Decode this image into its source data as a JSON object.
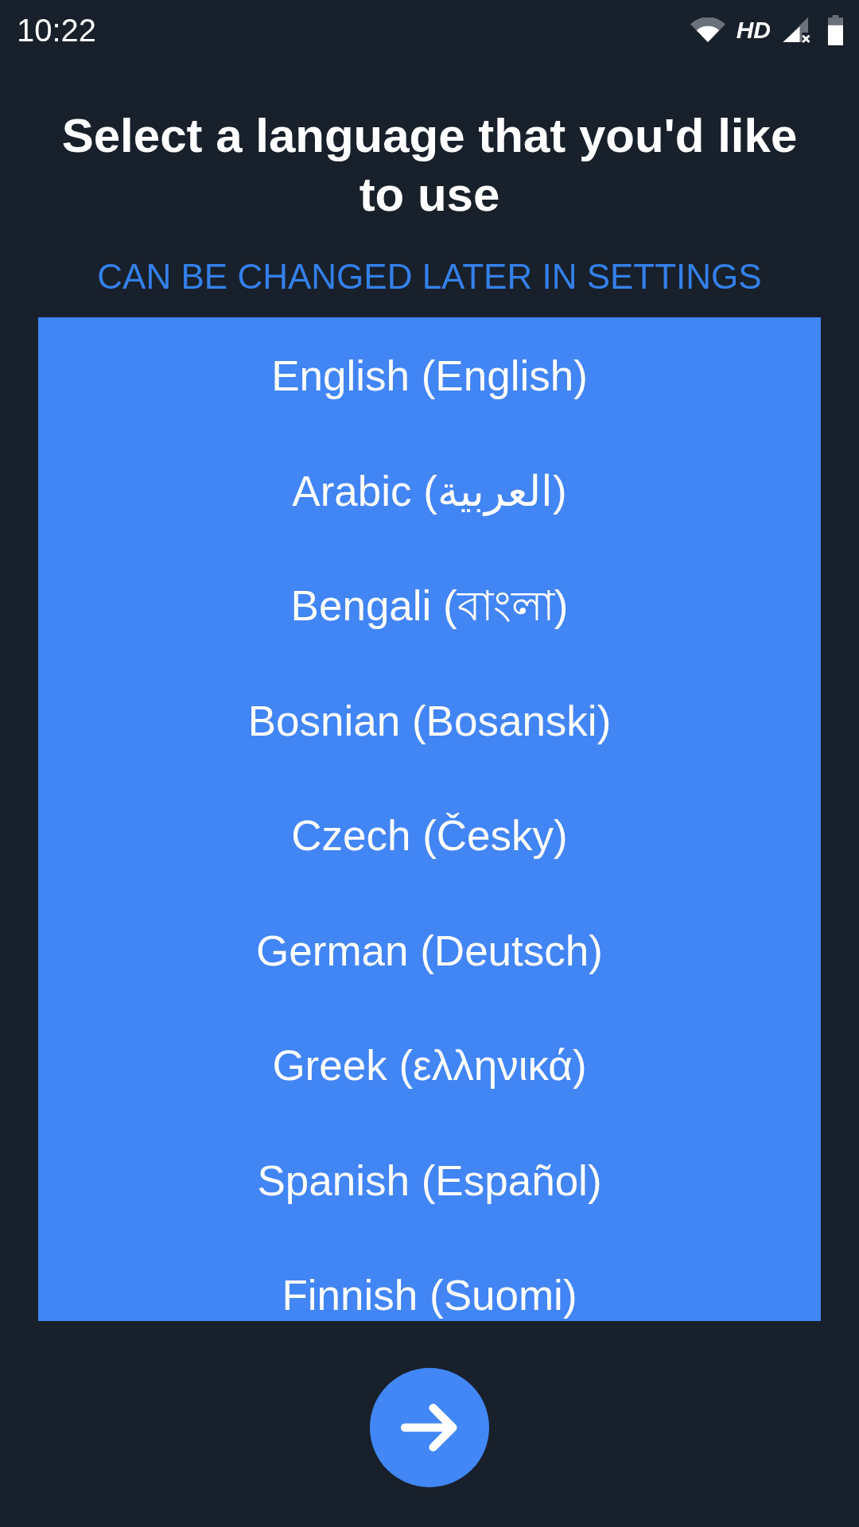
{
  "status_bar": {
    "time": "10:22",
    "network_type": "HD"
  },
  "title": "Select a language that you'd like to use",
  "subtitle": "CAN BE CHANGED LATER IN SETTINGS",
  "languages": [
    {
      "label": "English (English)"
    },
    {
      "label": "Arabic (العربية)"
    },
    {
      "label": "Bengali (বাংলা)"
    },
    {
      "label": "Bosnian (Bosanski)"
    },
    {
      "label": "Czech (Česky)"
    },
    {
      "label": "German (Deutsch)"
    },
    {
      "label": "Greek (ελληνικά)"
    },
    {
      "label": "Spanish (Español)"
    },
    {
      "label": "Finnish (Suomi)"
    }
  ]
}
